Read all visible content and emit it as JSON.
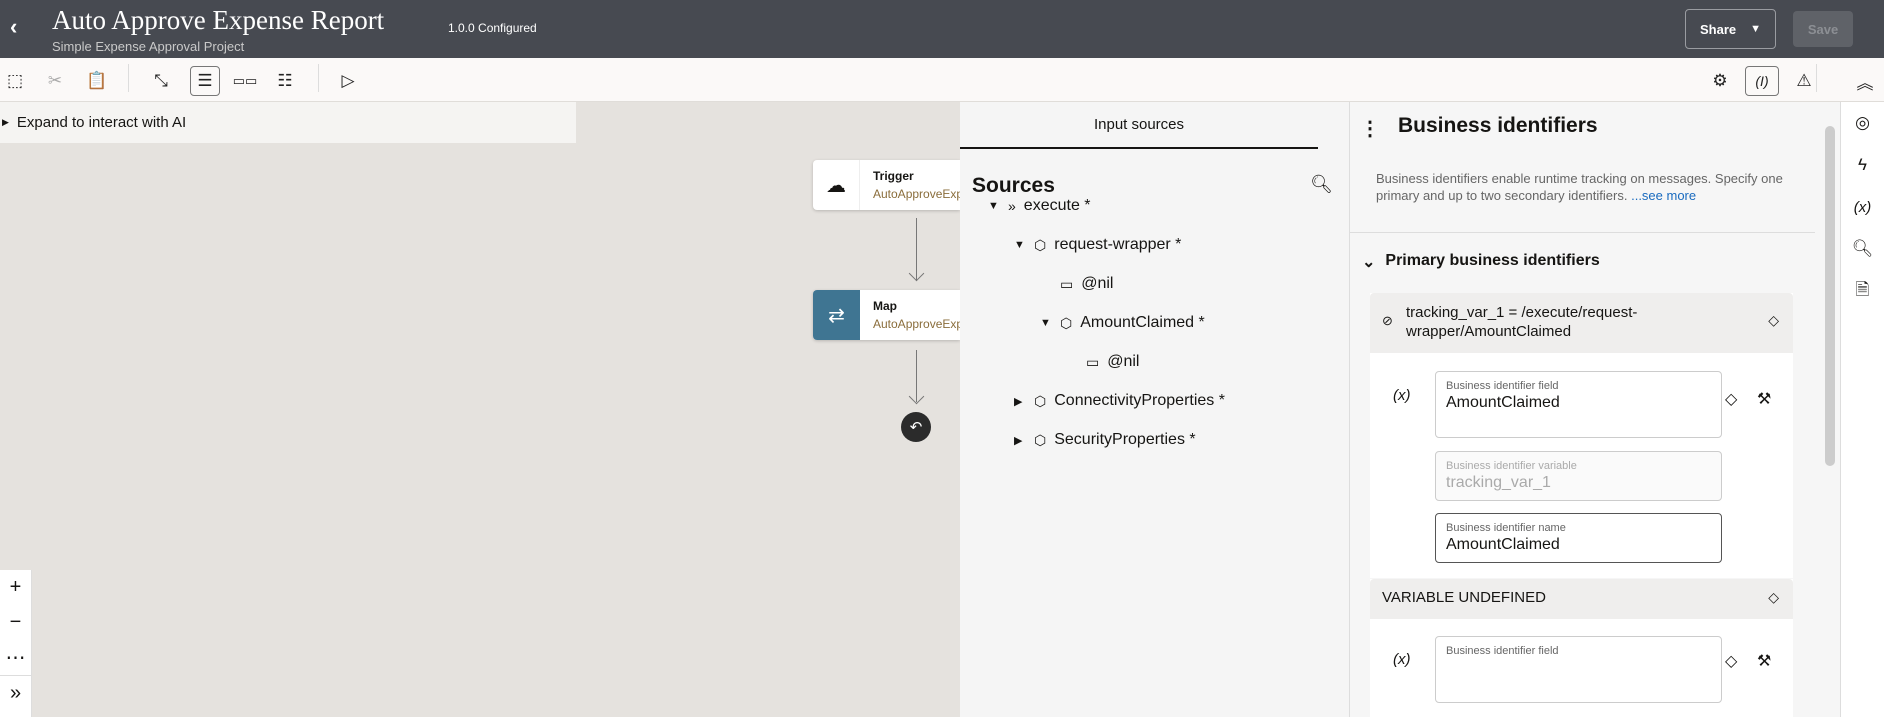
{
  "header": {
    "title": "Auto Approve Expense Report",
    "version": "1.0.0 Configured",
    "subtitle": "Simple Expense Approval Project",
    "share": "Share",
    "save": "Save"
  },
  "ai": {
    "label": "Expand to interact with AI"
  },
  "canvas": {
    "nodes": [
      {
        "title": "Trigger",
        "subtitle": "AutoApproveExp"
      },
      {
        "title": "Map",
        "subtitle": "AutoApproveExp"
      }
    ]
  },
  "input": {
    "tab": "Input sources",
    "heading": "Sources",
    "tree": [
      {
        "label": "execute *",
        "depth": 0,
        "tw": "▼",
        "icon": "»"
      },
      {
        "label": "request-wrapper *",
        "depth": 1,
        "tw": "▼",
        "icon": "⬡"
      },
      {
        "label": "@nil",
        "depth": 2,
        "tw": "",
        "icon": "▭"
      },
      {
        "label": "AmountClaimed *",
        "depth": 2,
        "tw": "▼",
        "icon": "⬡"
      },
      {
        "label": "@nil",
        "depth": 3,
        "tw": "",
        "icon": "▭"
      },
      {
        "label": "ConnectivityProperties *",
        "depth": 1,
        "tw": "▶",
        "icon": "⬡"
      },
      {
        "label": "SecurityProperties *",
        "depth": 1,
        "tw": "▶",
        "icon": "⬡"
      }
    ]
  },
  "biz": {
    "title": "Business identifiers",
    "desc": "Business identifiers enable runtime tracking on messages. Specify one primary and up to two secondary identifiers.",
    "see_more": "...see more",
    "primary": "Primary business identifiers",
    "card1": {
      "header": "tracking_var_1 = /execute/request-wrapper/AmountClaimed",
      "x": "(x)",
      "field_label": "Business identifier field",
      "field_value": "AmountClaimed",
      "var_label": "Business identifier variable",
      "var_value": "tracking_var_1",
      "name_label": "Business identifier name",
      "name_value": "AmountClaimed"
    },
    "card2": {
      "header": "VARIABLE UNDEFINED",
      "x": "(x)",
      "field_label": "Business identifier field"
    }
  }
}
